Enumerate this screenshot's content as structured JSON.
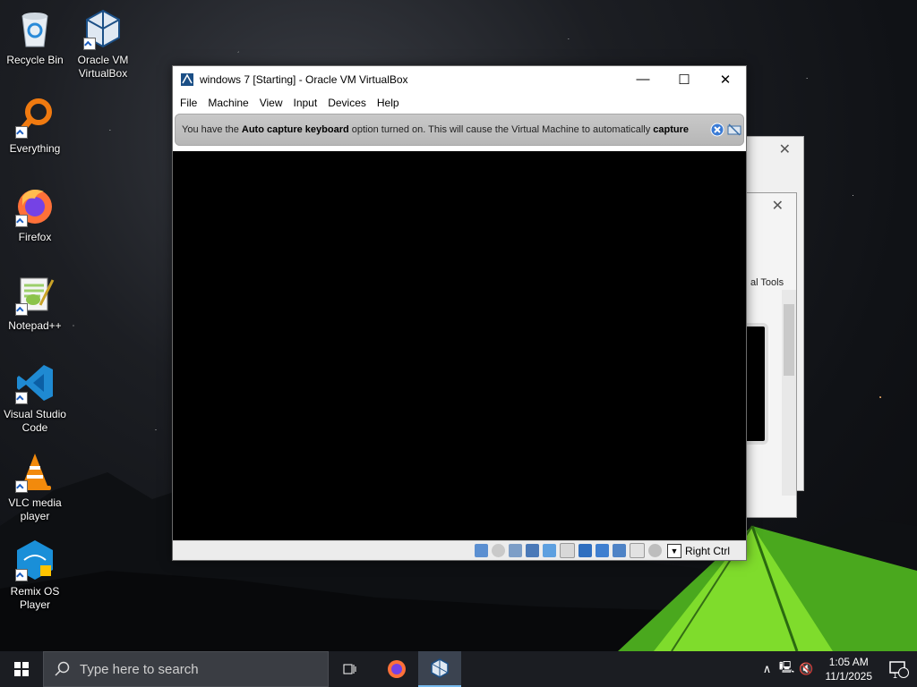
{
  "desktop": {
    "icons": [
      {
        "label": "Recycle Bin"
      },
      {
        "label": "Oracle VM VirtualBox"
      },
      {
        "label": "Everything"
      },
      {
        "label": "Firefox"
      },
      {
        "label": "Notepad++"
      },
      {
        "label": "Visual Studio Code"
      },
      {
        "label": "VLC media player"
      },
      {
        "label": "Remix OS Player"
      }
    ]
  },
  "background_window": {
    "close_glyph": "✕",
    "tools_label": "al Tools"
  },
  "vm_window": {
    "title": "windows 7 [Starting] - Oracle VM VirtualBox",
    "controls": {
      "minimize": "—",
      "maximize": "☐",
      "close": "✕"
    },
    "menu": [
      "File",
      "Machine",
      "View",
      "Input",
      "Devices",
      "Help"
    ],
    "notice": {
      "text_1": "You have the ",
      "bold_1": "Auto capture keyboard",
      "text_2": " option turned on. This will cause the Virtual Machine to automatically ",
      "bold_2": "capture"
    },
    "status": {
      "icons": [
        "hard-disk-icon",
        "optical-drive-icon",
        "audio-icon",
        "network-icon",
        "usb-icon",
        "shared-folders-icon",
        "display-icon",
        "recording-icon",
        "cpu-icon",
        "mouse-integration-icon",
        "host-key-icon"
      ],
      "host_key": "Right Ctrl"
    }
  },
  "taskbar": {
    "search_placeholder": "Type here to search",
    "time": "1:05 AM",
    "date": "11/1/2025",
    "notification_count": "1"
  }
}
